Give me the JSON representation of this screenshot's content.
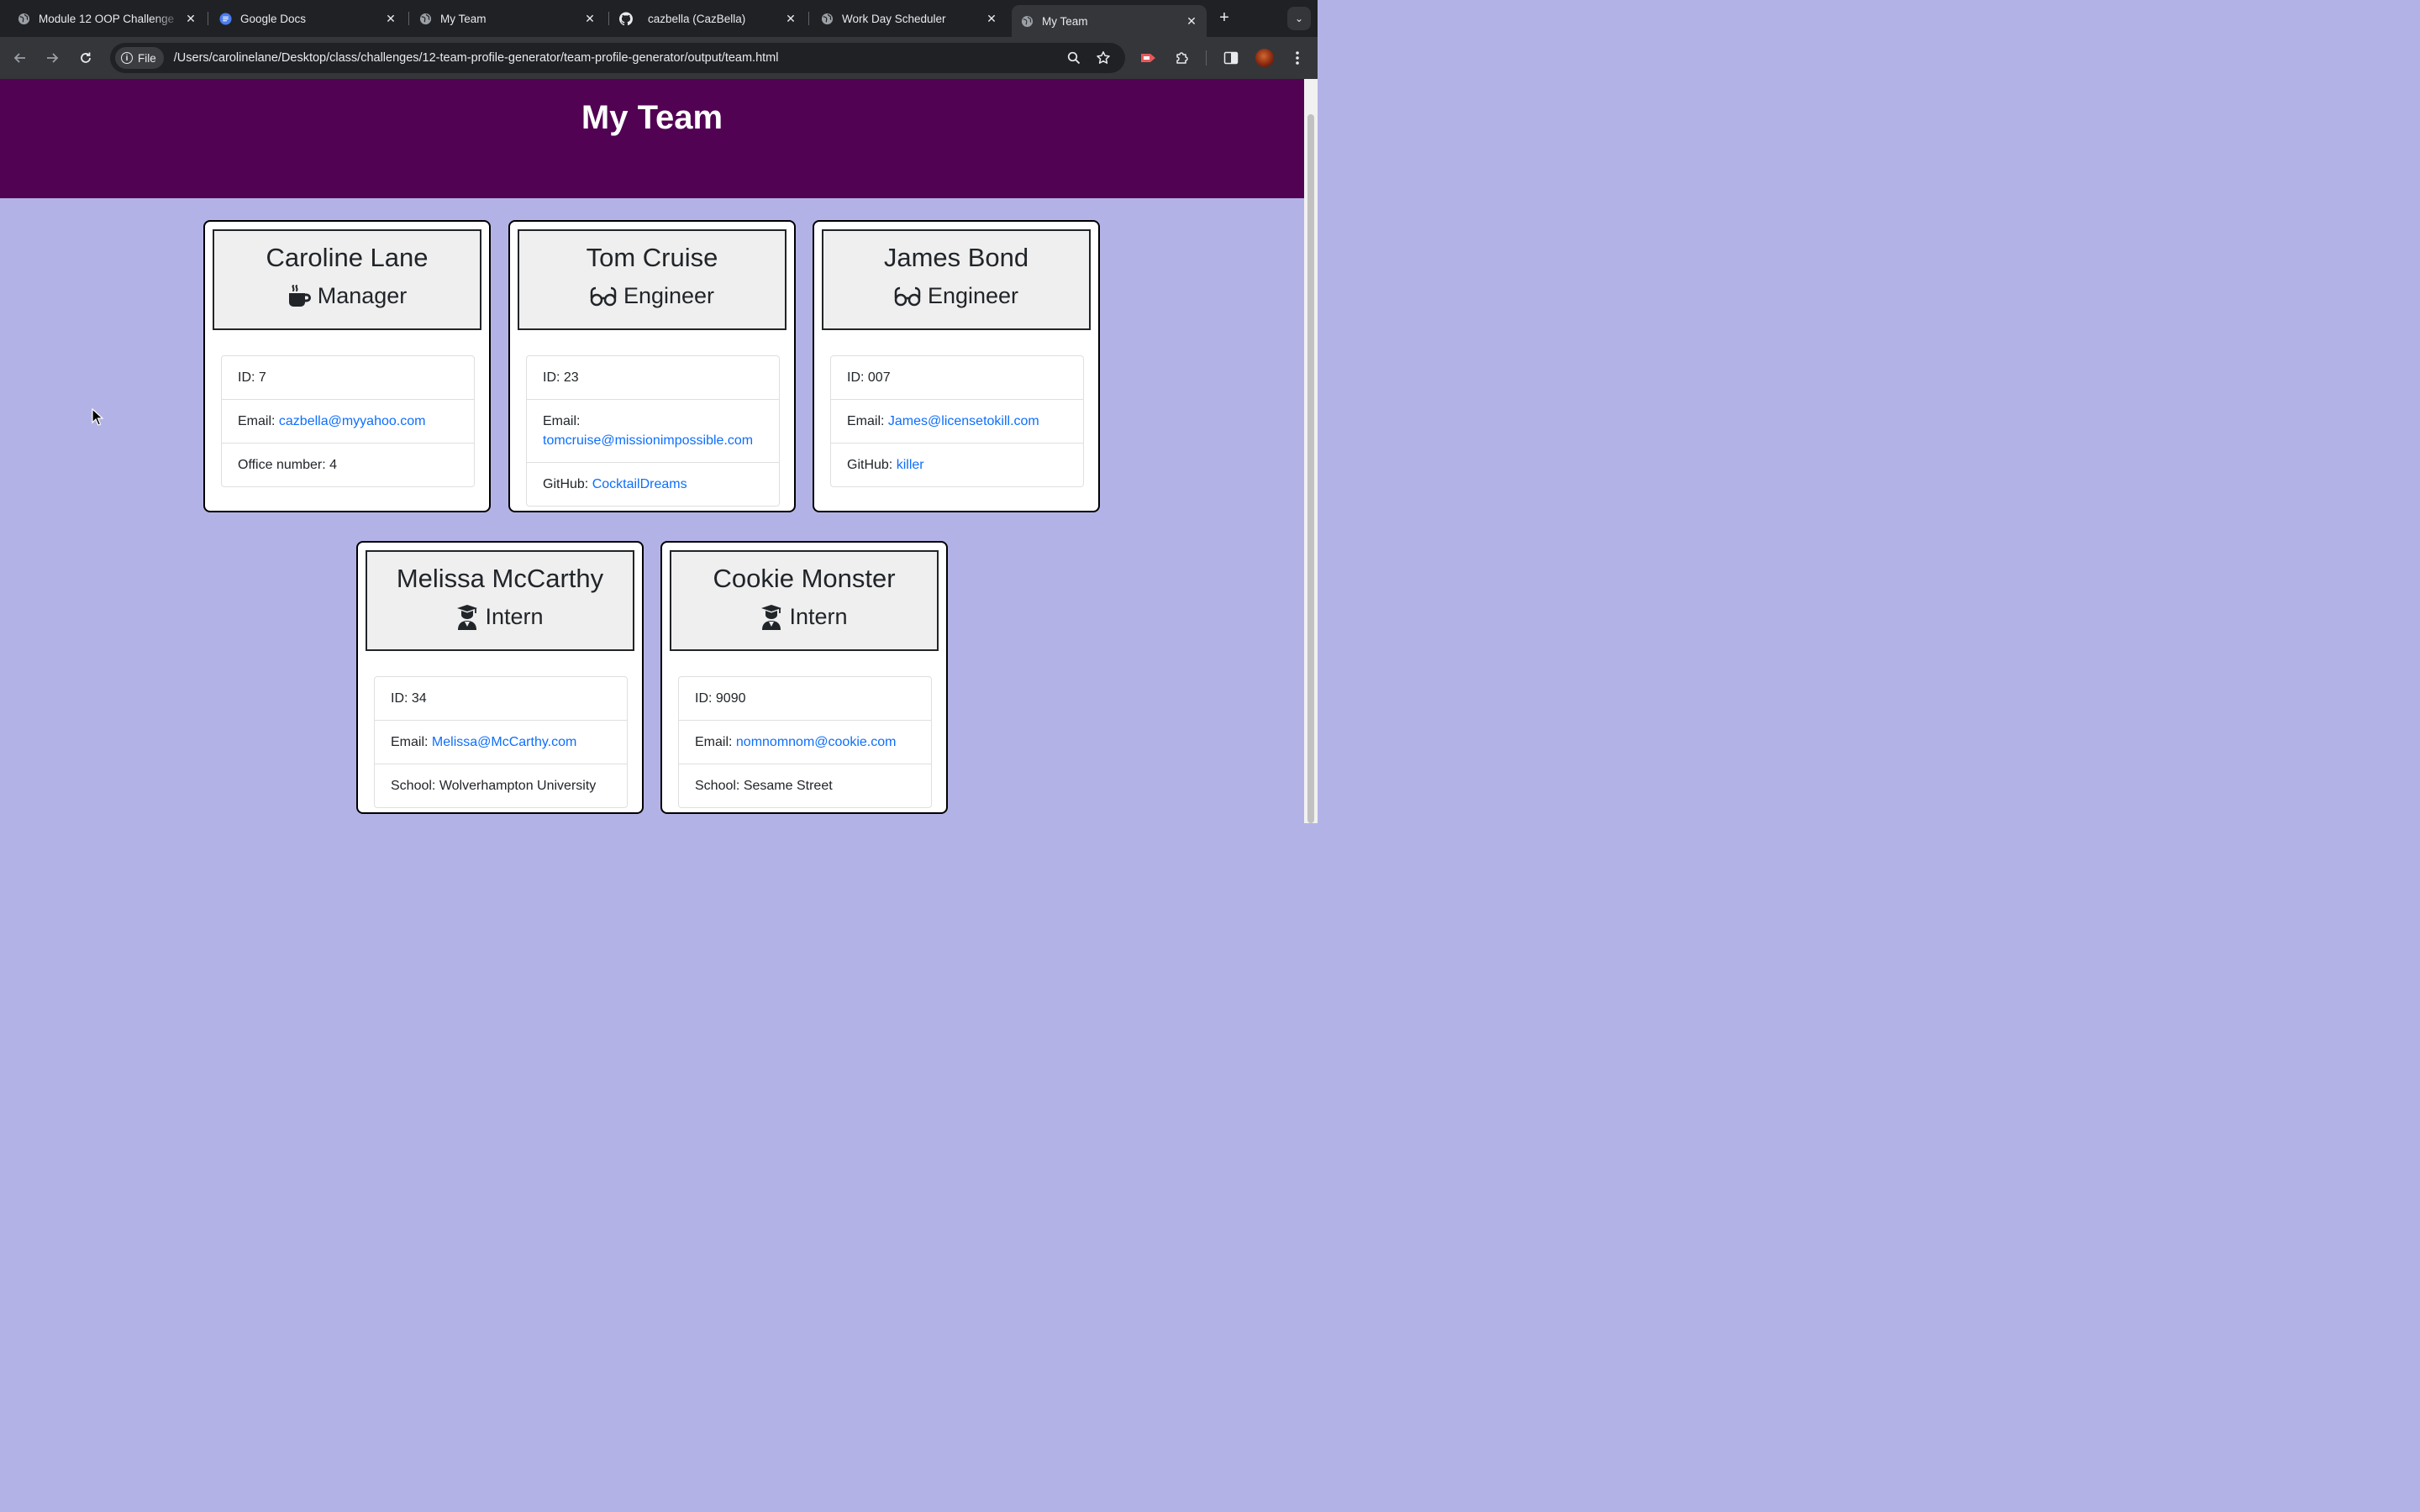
{
  "browser": {
    "tabs": [
      {
        "title": "Module 12 OOP Challenge",
        "icon": "globe-icon"
      },
      {
        "title": "Google Docs",
        "icon": "google-docs-icon"
      },
      {
        "title": "My Team",
        "icon": "globe-icon"
      },
      {
        "title": "cazbella (CazBella)",
        "icon": "github-icon"
      },
      {
        "title": "Work Day Scheduler",
        "icon": "globe-icon"
      },
      {
        "title": "My Team",
        "icon": "globe-icon",
        "active": true
      }
    ],
    "address_chip": "File",
    "url": "/Users/carolinelane/Desktop/class/challenges/12-team-profile-generator/team-profile-generator/output/team.html"
  },
  "page": {
    "title": "My Team",
    "employees": [
      {
        "name": "Caroline Lane",
        "role": "Manager",
        "icon": "mug-icon",
        "id_label": "ID:",
        "id": "7",
        "email_label": "Email:",
        "email": "cazbella@myyahoo.com",
        "extra_label": "Office number:",
        "extra": "4"
      },
      {
        "name": "Tom Cruise",
        "role": "Engineer",
        "icon": "glasses-icon",
        "id_label": "ID:",
        "id": "23",
        "email_label": "Email:",
        "email": "tomcruise@missionimpossible.com",
        "extra_label": "GitHub:",
        "extra": "CocktailDreams"
      },
      {
        "name": "James Bond",
        "role": "Engineer",
        "icon": "glasses-icon",
        "id_label": "ID:",
        "id": "007",
        "email_label": "Email:",
        "email": "James@licensetokill.com",
        "extra_label": "GitHub:",
        "extra": "killer"
      },
      {
        "name": "Melissa McCarthy",
        "role": "Intern",
        "icon": "graduate-icon",
        "id_label": "ID:",
        "id": "34",
        "email_label": "Email:",
        "email": "Melissa@McCarthy.com",
        "extra_label": "School:",
        "extra": "Wolverhampton University"
      },
      {
        "name": "Cookie Monster",
        "role": "Intern",
        "icon": "graduate-icon",
        "id_label": "ID:",
        "id": "9090",
        "email_label": "Email:",
        "email": "nomnomnom@cookie.com",
        "extra_label": "School:",
        "extra": "Sesame Street"
      }
    ]
  },
  "colors": {
    "header_bg": "#520252",
    "page_bg": "#b3b2e6",
    "link": "#0d6efd"
  }
}
